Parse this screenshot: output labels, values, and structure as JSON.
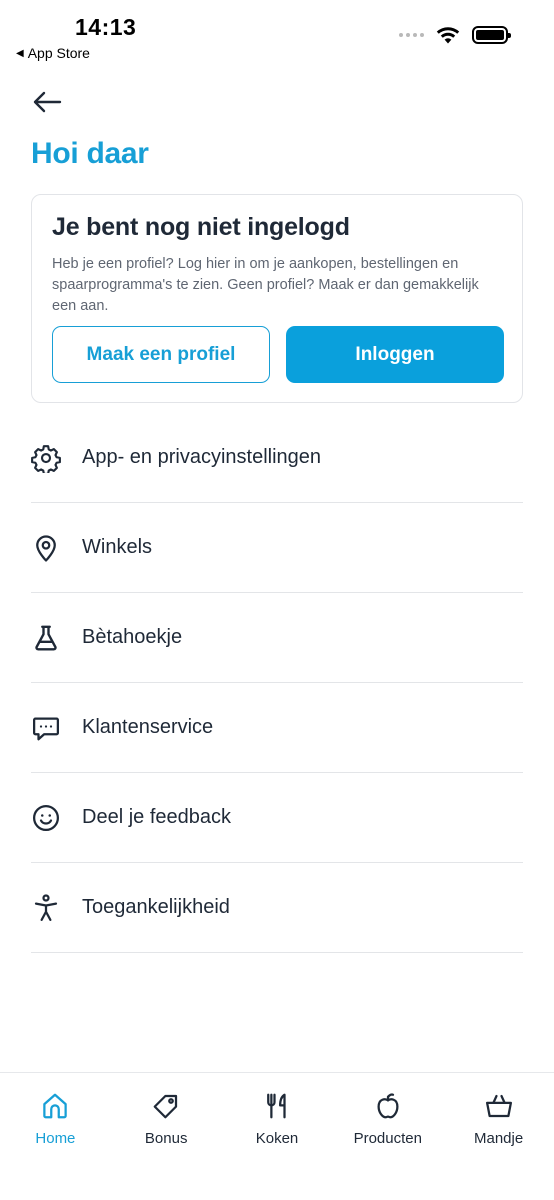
{
  "status_bar": {
    "time": "14:13",
    "back_label": "App Store"
  },
  "greeting": "Hoi daar",
  "login_card": {
    "title": "Je bent nog niet ingelogd",
    "text": "Heb je een profiel? Log hier in om je aankopen, bestellingen en spaarprogramma's te zien. Geen profiel? Maak er dan gemakkelijk een aan.",
    "create_profile_label": "Maak een profiel",
    "login_label": "Inloggen"
  },
  "menu": {
    "items": [
      {
        "label": "App- en privacyinstellingen",
        "icon": "gear-icon"
      },
      {
        "label": "Winkels",
        "icon": "location-pin-icon"
      },
      {
        "label": "Bètahoekje",
        "icon": "flask-icon"
      },
      {
        "label": "Klantenservice",
        "icon": "chat-bubble-icon"
      },
      {
        "label": "Deel je feedback",
        "icon": "smiley-icon"
      },
      {
        "label": "Toegankelijkheid",
        "icon": "accessibility-icon"
      }
    ]
  },
  "bottom_nav": {
    "items": [
      {
        "label": "Home",
        "icon": "home-icon",
        "active": true
      },
      {
        "label": "Bonus",
        "icon": "tag-icon",
        "active": false
      },
      {
        "label": "Koken",
        "icon": "cutlery-icon",
        "active": false
      },
      {
        "label": "Producten",
        "icon": "apple-icon",
        "active": false
      },
      {
        "label": "Mandje",
        "icon": "basket-icon",
        "active": false
      }
    ]
  },
  "colors": {
    "accent": "#179fd6",
    "primary_button": "#0aa0dc",
    "text": "#1f2937",
    "muted_text": "#5f6672",
    "divider": "#e3e5e8"
  }
}
